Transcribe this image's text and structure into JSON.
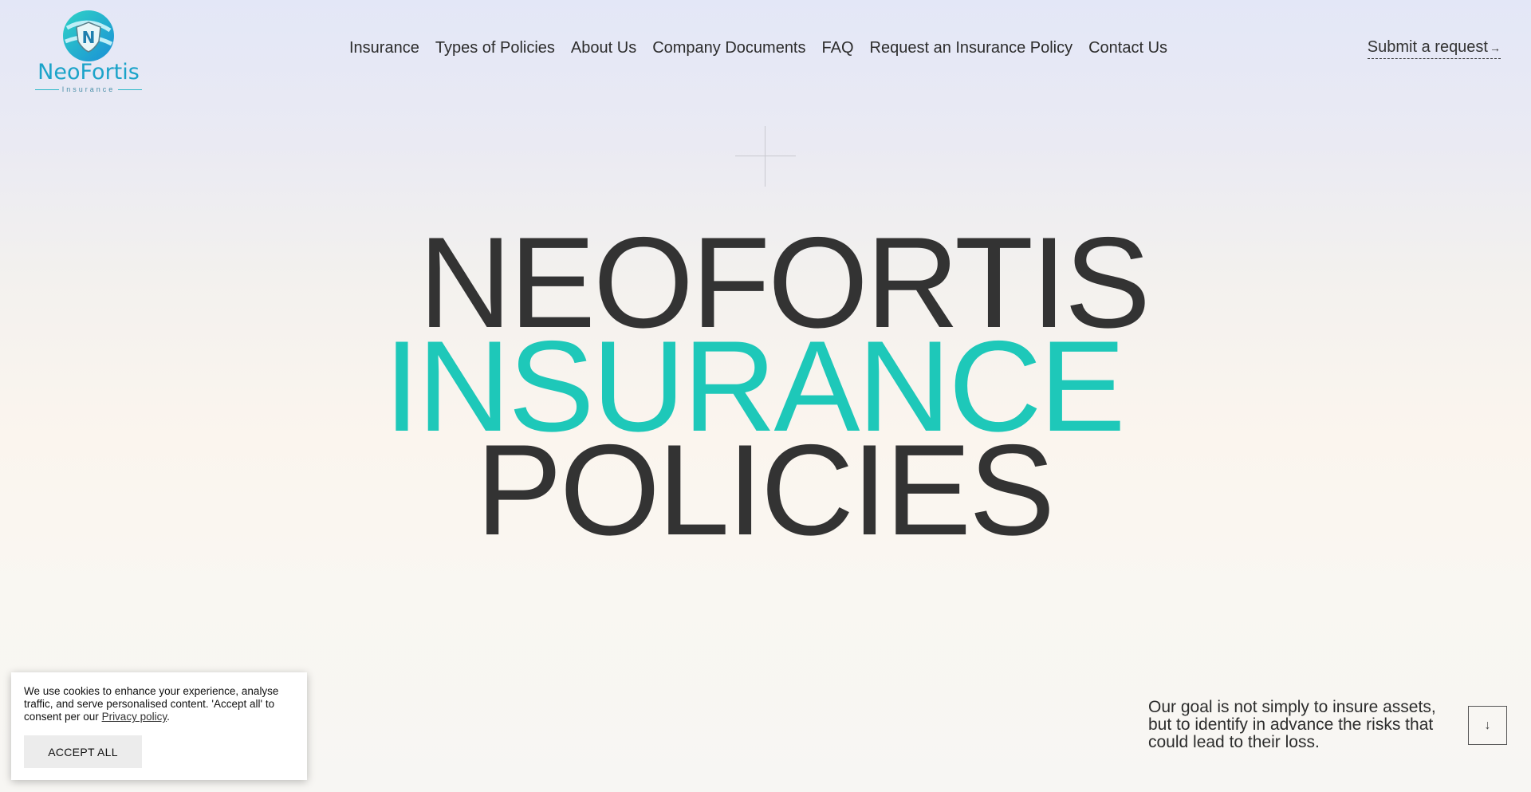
{
  "header": {
    "logo_text": "NeoFortis",
    "logo_sub": "Insurance",
    "nav": [
      {
        "label": "Insurance"
      },
      {
        "label": "Types of Policies"
      },
      {
        "label": "About Us"
      },
      {
        "label": "Company Documents"
      },
      {
        "label": "FAQ"
      },
      {
        "label": "Request an Insurance Policy"
      },
      {
        "label": "Contact Us"
      }
    ],
    "submit_label": "Submit a request",
    "submit_icon": "arrow-right-icon"
  },
  "hero": {
    "line1": "NEOFORTIS",
    "line2": "INSURANCE",
    "line3": "POLICIES",
    "accent_color": "#1ec8b9"
  },
  "cookie": {
    "text_before": "We use cookies to enhance your experience, analyse traffic, and serve personalised content. 'Accept all' to consent per our ",
    "link": "Privacy policy",
    "text_after": ".",
    "accept_label": "ACCEPT ALL"
  },
  "goal": {
    "text": "Our goal is not simply to insure assets, but to identify in advance the risks that could lead to their loss."
  },
  "scroll_button": {
    "icon": "arrow-down-icon",
    "glyph": "↓"
  }
}
